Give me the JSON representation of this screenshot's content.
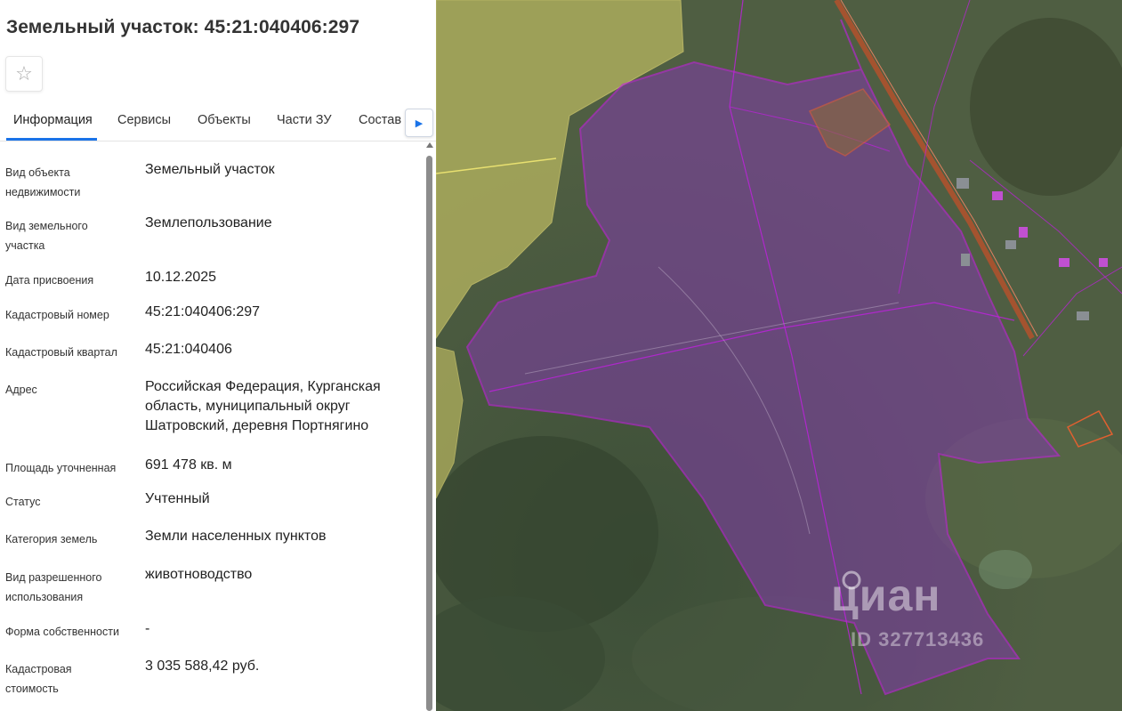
{
  "page": {
    "title": "Земельный участок: 45:21:040406:297",
    "favorite_icon": "star-icon"
  },
  "tabs": [
    "Информация",
    "Сервисы",
    "Объекты",
    "Части ЗУ",
    "Состав"
  ],
  "tab_next_icon": "triangle-right-icon",
  "info": [
    {
      "label": "Вид объекта недвижимости",
      "value": "Земельный участок"
    },
    {
      "label": "Вид земельного участка",
      "value": "Землепользование"
    },
    {
      "label": "Дата присвоения",
      "value": "10.12.2025"
    },
    {
      "label": "Кадастровый номер",
      "value": "45:21:040406:297"
    },
    {
      "label": "Кадастровый квартал",
      "value": "45:21:040406"
    },
    {
      "label": "Адрес",
      "value": "Российская Федерация, Курганская область, муниципальный округ Шатровский, деревня Портнягино"
    },
    {
      "label": "Площадь уточненная",
      "value": "691 478 кв. м"
    },
    {
      "label": "Статус",
      "value": "Учтенный"
    },
    {
      "label": "Категория земель",
      "value": "Земли населенных пунктов"
    },
    {
      "label": "Вид разрешенного использования",
      "value": "животноводство"
    },
    {
      "label": "Форма собственности",
      "value": "-"
    },
    {
      "label": "Кадастровая стоимость",
      "value": "3 035 588,42 руб."
    }
  ],
  "map": {
    "watermark": "циан",
    "watermark_id": "ID 327713436",
    "colors": {
      "parcel_fill": "#7b3f9e",
      "parcel_border": "#c020e0",
      "neighbor_fill": "#c8c060",
      "road": "#c0502a",
      "terrain": "#4a5a3e"
    }
  }
}
